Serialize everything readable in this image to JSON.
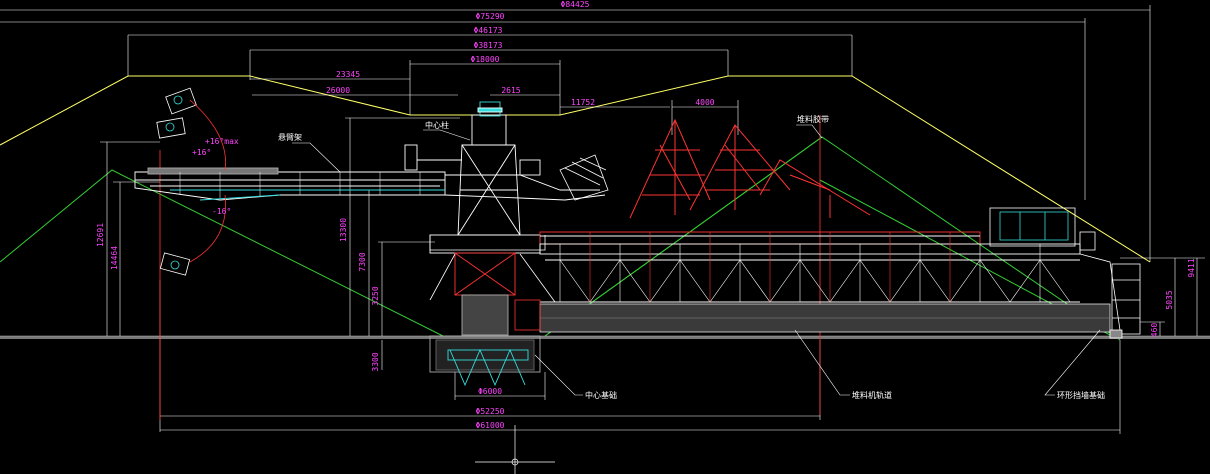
{
  "colors": {
    "background": "#000000",
    "dimension": "#ff44ff",
    "pile_outline": "#ffff66",
    "slope": "#33cc33",
    "structure": "#ffffff",
    "steel_red": "#ff3333",
    "cyan": "#33dddd",
    "ground": "#999999",
    "ext_line": "#cccccc"
  },
  "dimensions": {
    "top_span_1": "Φ84425",
    "top_span_2": "Φ75290",
    "top_span_3": "Φ46173",
    "top_span_4": "Φ38173",
    "center_span": "Φ18000",
    "left_1": "23345",
    "left_2": "26000",
    "right_small": "2615",
    "right_mid": "11752",
    "shed_span": "4000",
    "angle_up": "+16°max",
    "angle_mid": "+16°",
    "angle_down": "-16°",
    "v_left_1": "12691",
    "v_left_2": "14464",
    "v_mast": "13300",
    "v_column": "7300",
    "v_boom": "3250",
    "v_pit": "3300",
    "v_right_1": "9411",
    "v_right_2": "5035",
    "v_right_3": "460",
    "bottom_1": "Φ6000",
    "bottom_2": "Φ52250",
    "bottom_3": "Φ61000"
  },
  "labels": {
    "boom": "悬臂架",
    "center_column": "中心柱",
    "shed": "堆料胶带",
    "center_foundation": "中心基础",
    "circular_track": "堆料机轨道",
    "retaining_wall": "环形挡墙基础"
  }
}
